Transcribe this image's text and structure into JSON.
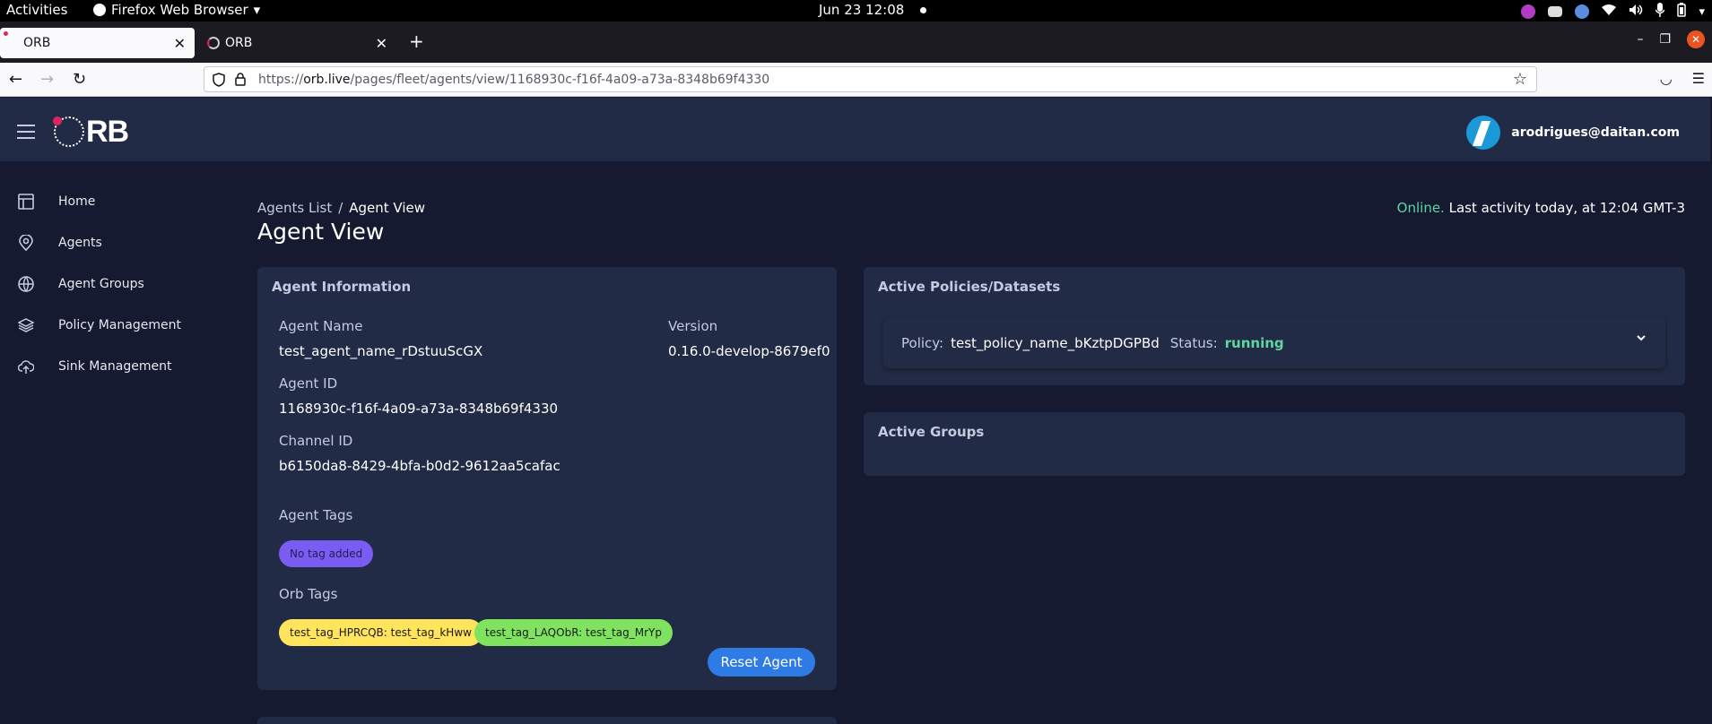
{
  "system_bar": {
    "activities": "Activities",
    "app_name": "Firefox Web Browser",
    "clock": "Jun 23  12:08"
  },
  "browser": {
    "tabs": [
      {
        "title": "ORB",
        "active": true
      },
      {
        "title": "ORB",
        "active": false
      }
    ],
    "url_prefix": "https://",
    "url_host": "orb.live",
    "url_path": "/pages/fleet/agents/view/1168930c-f16f-4a09-a73a-8348b69f4330"
  },
  "header": {
    "logo_text": "RB",
    "user_email": "arodrigues@daitan.com"
  },
  "sidebar": {
    "items": [
      {
        "label": "Home",
        "icon": "layout-icon"
      },
      {
        "label": "Agents",
        "icon": "map-pin-icon"
      },
      {
        "label": "Agent Groups",
        "icon": "globe-icon"
      },
      {
        "label": "Policy Management",
        "icon": "layers-icon"
      },
      {
        "label": "Sink Management",
        "icon": "cloud-upload-icon"
      }
    ]
  },
  "breadcrumb": {
    "parent": "Agents List",
    "separator": "/",
    "current": "Agent View"
  },
  "page": {
    "title": "Agent View",
    "status_online": "Online.",
    "status_activity": " Last activity today, at 12:04 GMT-3"
  },
  "agent_info": {
    "title": "Agent Information",
    "name_label": "Agent Name",
    "name_value": "test_agent_name_rDstuuScGX",
    "version_label": "Version",
    "version_value": "0.16.0-develop-8679ef0",
    "id_label": "Agent ID",
    "id_value": "1168930c-f16f-4a09-a73a-8348b69f4330",
    "channel_label": "Channel ID",
    "channel_value": "b6150da8-8429-4bfa-b0d2-9612aa5cafac",
    "agent_tags_label": "Agent Tags",
    "no_tag": "No tag added",
    "orb_tags_label": "Orb Tags",
    "orb_tags": [
      "test_tag_HPRCQB: test_tag_kHww",
      "test_tag_LAQObR: test_tag_MrYp"
    ],
    "reset_button": "Reset Agent"
  },
  "policies": {
    "title": "Active Policies/Datasets",
    "policy_key": "Policy:",
    "policy_name": "test_policy_name_bKztpDGPBd",
    "status_key": "Status:",
    "status_value": "running"
  },
  "groups": {
    "title": "Active Groups"
  },
  "colors": {
    "accent": "#2f7be6",
    "online": "#5fd6a0",
    "background": "#151a30",
    "card": "#222b45"
  }
}
